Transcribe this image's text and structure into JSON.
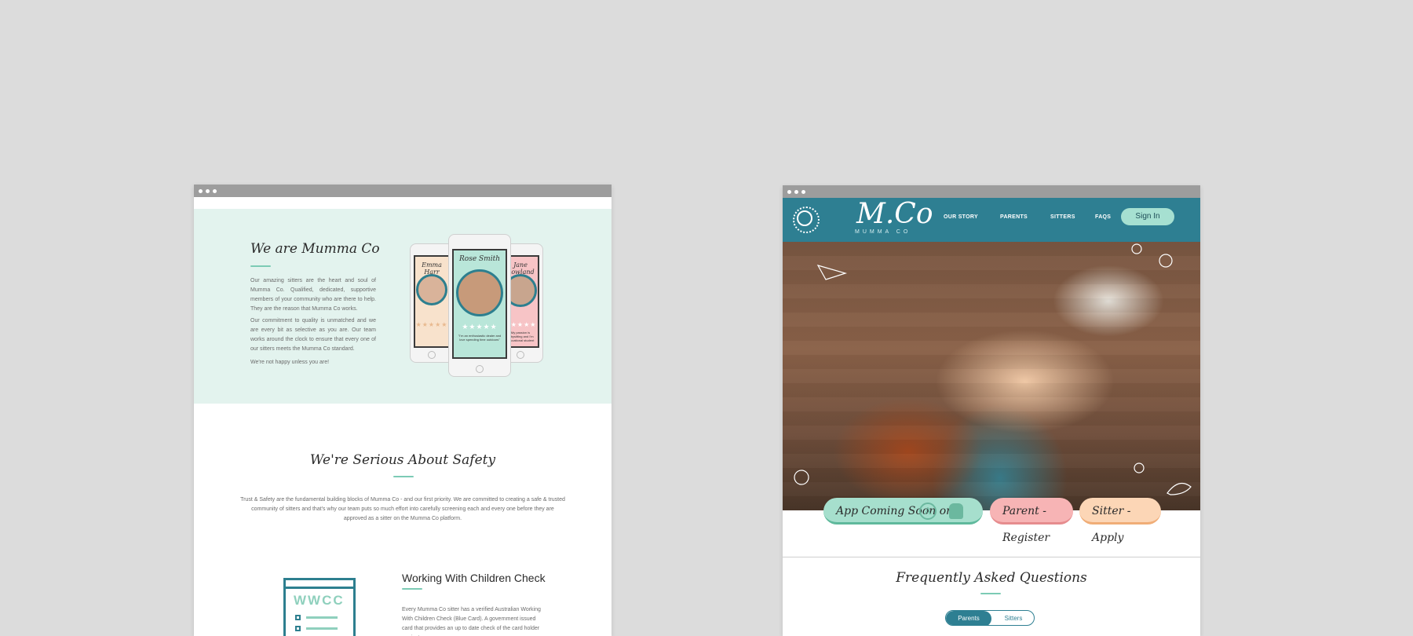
{
  "left": {
    "about": {
      "title": "We are Mumma Co",
      "p1": "Our amazing sitters are the heart and soul of Mumma Co. Qualified, dedicated, supportive members of your community who are there to help. They are the reason that Mumma Co works.",
      "p2": "Our commitment to quality is unmatched and we are every bit as selective as you are. Our team works around the clock to ensure that every one of our sitters meets the Mumma Co standard.",
      "p3": "We're not happy unless you are!"
    },
    "phones": [
      {
        "name": "Emma Harr",
        "stars": "★★★★★",
        "quote": ""
      },
      {
        "name": "Rose Smith",
        "stars": "★★★★★",
        "quote": "\"I'm an enthusiastic dealer and love spending time outdoors\""
      },
      {
        "name": "Jane Rowland",
        "stars": "★★★★★",
        "quote": "My passion is babysitting and I'm educational student"
      }
    ],
    "safety": {
      "title": "We're Serious About Safety",
      "text": "Trust & Safety are the fundamental building blocks of Mumma Co - and our first priority. We are committed to creating a safe & trusted community of sitters and that's why our team puts so much effort into carefully screening each and every one before they are approved as a sitter on the Mumma Co platform."
    },
    "wwcc": {
      "icon_text": "WWCC",
      "title": "Working With Children Check",
      "text": "Every Mumma Co sitter has a verified Australian Working With Children Check (Blue Card). A government issued card that provides an up to date check of the card holder against"
    }
  },
  "right": {
    "logo": "M.Co",
    "logo_sub": "MUMMA CO",
    "nav": [
      "OUR STORY",
      "PARENTS",
      "SITTERS",
      "FAQS"
    ],
    "signin": "Sign In",
    "cta": {
      "app": "App Coming Soon on",
      "parent": "Parent - Register",
      "sitter": "Sitter - Apply"
    },
    "faq": {
      "title": "Frequently Asked Questions",
      "tabs": [
        "Parents",
        "Sitters"
      ]
    }
  }
}
